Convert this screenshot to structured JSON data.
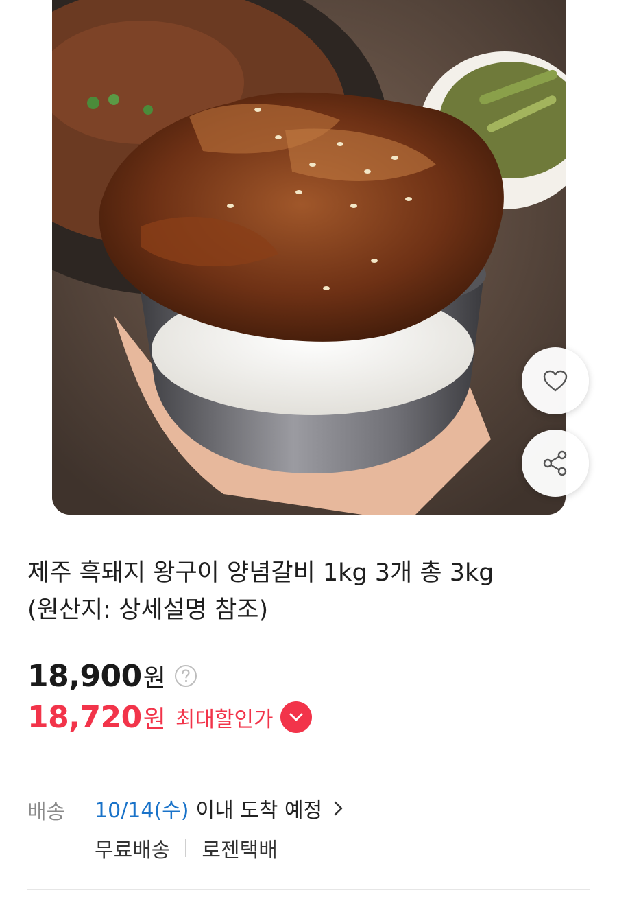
{
  "product": {
    "image_alt": "",
    "title_line1": "제주 흑돼지 왕구이 양념갈비 1kg 3개 총 3kg",
    "title_line2": "(원산지: 상세설명 참조)"
  },
  "actions": {
    "like_icon": "heart-icon",
    "share_icon": "share-icon"
  },
  "price": {
    "original_amount": "18,900",
    "original_unit": "원",
    "sale_amount": "18,720",
    "sale_unit": "원",
    "sale_label": "최대할인가",
    "sale_color": "#f2344a"
  },
  "delivery": {
    "label": "배송",
    "date": "10/14(수)",
    "arrival_text": "이내 도착 예정",
    "fee": "무료배송",
    "carrier": "로젠택배",
    "date_color": "#1a73c9"
  }
}
